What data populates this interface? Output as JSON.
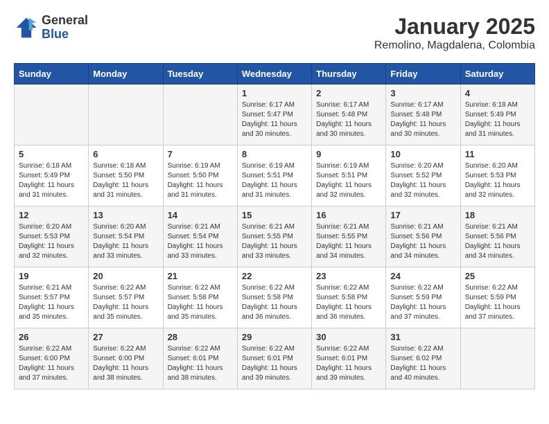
{
  "logo": {
    "general": "General",
    "blue": "Blue"
  },
  "header": {
    "month": "January 2025",
    "location": "Remolino, Magdalena, Colombia"
  },
  "weekdays": [
    "Sunday",
    "Monday",
    "Tuesday",
    "Wednesday",
    "Thursday",
    "Friday",
    "Saturday"
  ],
  "weeks": [
    [
      {
        "day": "",
        "info": ""
      },
      {
        "day": "",
        "info": ""
      },
      {
        "day": "",
        "info": ""
      },
      {
        "day": "1",
        "info": "Sunrise: 6:17 AM\nSunset: 5:47 PM\nDaylight: 11 hours\nand 30 minutes."
      },
      {
        "day": "2",
        "info": "Sunrise: 6:17 AM\nSunset: 5:48 PM\nDaylight: 11 hours\nand 30 minutes."
      },
      {
        "day": "3",
        "info": "Sunrise: 6:17 AM\nSunset: 5:48 PM\nDaylight: 11 hours\nand 30 minutes."
      },
      {
        "day": "4",
        "info": "Sunrise: 6:18 AM\nSunset: 5:49 PM\nDaylight: 11 hours\nand 31 minutes."
      }
    ],
    [
      {
        "day": "5",
        "info": "Sunrise: 6:18 AM\nSunset: 5:49 PM\nDaylight: 11 hours\nand 31 minutes."
      },
      {
        "day": "6",
        "info": "Sunrise: 6:18 AM\nSunset: 5:50 PM\nDaylight: 11 hours\nand 31 minutes."
      },
      {
        "day": "7",
        "info": "Sunrise: 6:19 AM\nSunset: 5:50 PM\nDaylight: 11 hours\nand 31 minutes."
      },
      {
        "day": "8",
        "info": "Sunrise: 6:19 AM\nSunset: 5:51 PM\nDaylight: 11 hours\nand 31 minutes."
      },
      {
        "day": "9",
        "info": "Sunrise: 6:19 AM\nSunset: 5:51 PM\nDaylight: 11 hours\nand 32 minutes."
      },
      {
        "day": "10",
        "info": "Sunrise: 6:20 AM\nSunset: 5:52 PM\nDaylight: 11 hours\nand 32 minutes."
      },
      {
        "day": "11",
        "info": "Sunrise: 6:20 AM\nSunset: 5:53 PM\nDaylight: 11 hours\nand 32 minutes."
      }
    ],
    [
      {
        "day": "12",
        "info": "Sunrise: 6:20 AM\nSunset: 5:53 PM\nDaylight: 11 hours\nand 32 minutes."
      },
      {
        "day": "13",
        "info": "Sunrise: 6:20 AM\nSunset: 5:54 PM\nDaylight: 11 hours\nand 33 minutes."
      },
      {
        "day": "14",
        "info": "Sunrise: 6:21 AM\nSunset: 5:54 PM\nDaylight: 11 hours\nand 33 minutes."
      },
      {
        "day": "15",
        "info": "Sunrise: 6:21 AM\nSunset: 5:55 PM\nDaylight: 11 hours\nand 33 minutes."
      },
      {
        "day": "16",
        "info": "Sunrise: 6:21 AM\nSunset: 5:55 PM\nDaylight: 11 hours\nand 34 minutes."
      },
      {
        "day": "17",
        "info": "Sunrise: 6:21 AM\nSunset: 5:56 PM\nDaylight: 11 hours\nand 34 minutes."
      },
      {
        "day": "18",
        "info": "Sunrise: 6:21 AM\nSunset: 5:56 PM\nDaylight: 11 hours\nand 34 minutes."
      }
    ],
    [
      {
        "day": "19",
        "info": "Sunrise: 6:21 AM\nSunset: 5:57 PM\nDaylight: 11 hours\nand 35 minutes."
      },
      {
        "day": "20",
        "info": "Sunrise: 6:22 AM\nSunset: 5:57 PM\nDaylight: 11 hours\nand 35 minutes."
      },
      {
        "day": "21",
        "info": "Sunrise: 6:22 AM\nSunset: 5:58 PM\nDaylight: 11 hours\nand 35 minutes."
      },
      {
        "day": "22",
        "info": "Sunrise: 6:22 AM\nSunset: 5:58 PM\nDaylight: 11 hours\nand 36 minutes."
      },
      {
        "day": "23",
        "info": "Sunrise: 6:22 AM\nSunset: 5:58 PM\nDaylight: 11 hours\nand 36 minutes."
      },
      {
        "day": "24",
        "info": "Sunrise: 6:22 AM\nSunset: 5:59 PM\nDaylight: 11 hours\nand 37 minutes."
      },
      {
        "day": "25",
        "info": "Sunrise: 6:22 AM\nSunset: 5:59 PM\nDaylight: 11 hours\nand 37 minutes."
      }
    ],
    [
      {
        "day": "26",
        "info": "Sunrise: 6:22 AM\nSunset: 6:00 PM\nDaylight: 11 hours\nand 37 minutes."
      },
      {
        "day": "27",
        "info": "Sunrise: 6:22 AM\nSunset: 6:00 PM\nDaylight: 11 hours\nand 38 minutes."
      },
      {
        "day": "28",
        "info": "Sunrise: 6:22 AM\nSunset: 6:01 PM\nDaylight: 11 hours\nand 38 minutes."
      },
      {
        "day": "29",
        "info": "Sunrise: 6:22 AM\nSunset: 6:01 PM\nDaylight: 11 hours\nand 39 minutes."
      },
      {
        "day": "30",
        "info": "Sunrise: 6:22 AM\nSunset: 6:01 PM\nDaylight: 11 hours\nand 39 minutes."
      },
      {
        "day": "31",
        "info": "Sunrise: 6:22 AM\nSunset: 6:02 PM\nDaylight: 11 hours\nand 40 minutes."
      },
      {
        "day": "",
        "info": ""
      }
    ]
  ]
}
